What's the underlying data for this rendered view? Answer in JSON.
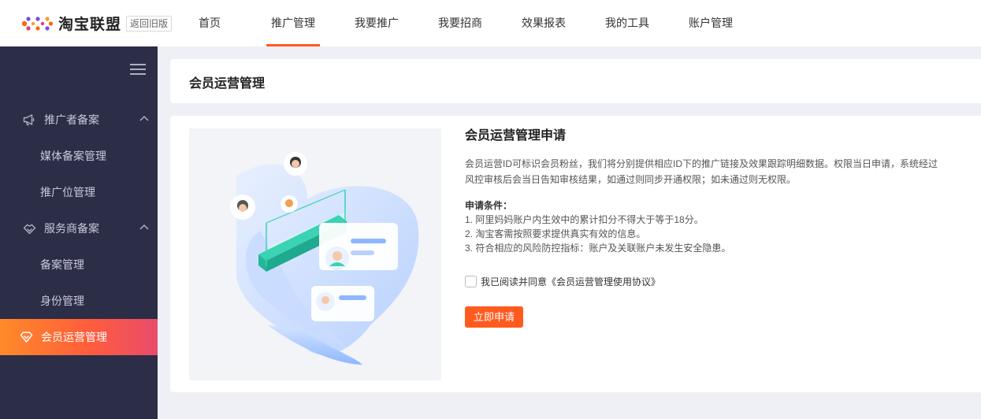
{
  "header": {
    "logo_text": "淘宝联盟",
    "old_version_label": "返回旧版",
    "nav": [
      {
        "label": "首页"
      },
      {
        "label": "推广管理",
        "active": true
      },
      {
        "label": "我要推广"
      },
      {
        "label": "我要招商"
      },
      {
        "label": "效果报表"
      },
      {
        "label": "我的工具"
      },
      {
        "label": "账户管理"
      }
    ],
    "accent_color": "#ff5b1f"
  },
  "sidebar": {
    "groups": [
      {
        "label": "推广者备案",
        "icon": "megaphone-icon",
        "items": [
          {
            "label": "媒体备案管理"
          },
          {
            "label": "推广位管理"
          }
        ]
      },
      {
        "label": "服务商备案",
        "icon": "handshake-icon",
        "items": [
          {
            "label": "备案管理"
          },
          {
            "label": "身份管理"
          }
        ]
      }
    ],
    "active_item": {
      "label": "会员运营管理",
      "icon": "heart-diamond-icon"
    },
    "bg_color": "#2c2d47"
  },
  "page": {
    "title": "会员运营管理"
  },
  "application": {
    "heading": "会员运营管理申请",
    "description": "会员运营ID可标识会员粉丝，我们将分别提供相应ID下的推广链接及效果跟踪明细数据。权限当日申请，系统经过风控审核后会当日告知审核结果，如通过则同步开通权限；如未通过则无权限。",
    "conditions_title": "申请条件：",
    "conditions": [
      "1. 阿里妈妈账户内生效中的累计扣分不得大于等于18分。",
      "2. 淘宝客需按照要求提供真实有效的信息。",
      "3. 符合相应的风险防控指标：账户及关联账户未发生安全隐患。"
    ],
    "agree_text": "我已阅读并同意《会员运营管理使用协议》",
    "agree_checked": false,
    "apply_button": "立即申请"
  }
}
